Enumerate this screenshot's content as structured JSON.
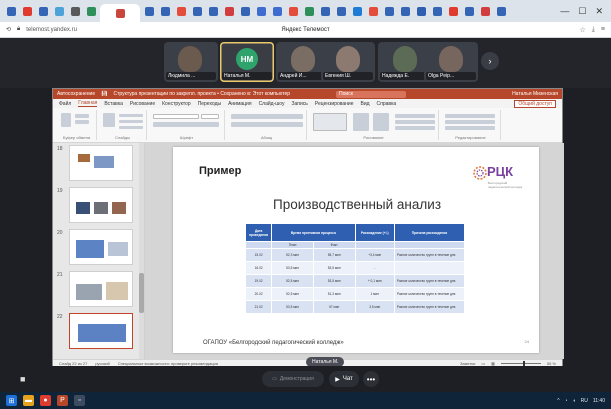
{
  "browser": {
    "url": "telemost.yandex.ru",
    "page_title": "Яндекс Телемост",
    "tab_icon_colors": [
      "#3466b5",
      "#e03b2f",
      "#3466b5",
      "#4da3d8",
      "#5a5a5a",
      "#2f8f5b",
      "#c9463d",
      "#3466b5",
      "#3466b5",
      "#e24d3c",
      "#3466b5",
      "#3466b5",
      "#d23d3d",
      "#3466b5",
      "#3f6ccf",
      "#3f6ccf",
      "#e24d3c",
      "#2f8f5b",
      "#3466b5",
      "#3466b5",
      "#1e7bd6",
      "#e24d3c",
      "#3466b5",
      "#3466b5",
      "#2e5fb0",
      "#3466b5",
      "#e03b2f",
      "#3466b5",
      "#d23d3d",
      "#3466b5"
    ]
  },
  "participants": [
    {
      "name": "Людмила ...",
      "initials": "",
      "photo_color": "#6b5a4e"
    },
    {
      "name": "Наталья М.",
      "initials": "НМ",
      "speaking": true
    },
    {
      "name": "Андрей И...",
      "initials": "",
      "photo_color": "#7a6d63"
    },
    {
      "name": "Евгения Ш.",
      "initials": "",
      "photo_color": "#8c7a70"
    },
    {
      "name": "Надежда Е.",
      "initials": "",
      "photo_color": "#5c6b55"
    },
    {
      "name": "Olga Рeip...",
      "initials": "",
      "photo_color": "#77665e"
    }
  ],
  "ppt": {
    "autosave_label": "Автосохранение",
    "doc_title": "Структура презентации по закрепл. проекта • Сохранено в: Этот компьютер",
    "search_placeholder": "Поиск",
    "user_name": "Наталья Мизенская",
    "menu": [
      "Файл",
      "Главная",
      "Вставка",
      "Рисование",
      "Конструктор",
      "Переходы",
      "Анимация",
      "Слайд-шоу",
      "Запись",
      "Рецензирование",
      "Вид",
      "Справка"
    ],
    "menu_active": "Главная",
    "share_label": "Общий доступ",
    "ribbon_groups": [
      "Буфер обмена",
      "Слайды",
      "Шрифт",
      "Абзац",
      "Рисование",
      "Редактирование"
    ],
    "slide_numbers": [
      "18",
      "19",
      "20",
      "21",
      "22"
    ],
    "status_text": "Слайд 22 из 27",
    "status_lang": "русский",
    "status_access": "Специальные возможности: проверьте рекомендации",
    "status_notes": "Заметки",
    "zoom": "55 %"
  },
  "slide": {
    "header": "Пример",
    "title": "Производственный анализ",
    "logo_text": "РЦК",
    "logo_sub": "Белгородский педагогический колледж",
    "footer": "ОГАПОУ «Белгородский педагогический колледж»",
    "number": "24",
    "table": {
      "headers": [
        "Дата проведения",
        "Время протекания процесса",
        "",
        "Расхождение (+/-)",
        "Причина расхождения"
      ],
      "subheaders": [
        "",
        "План",
        "Факт",
        "",
        ""
      ],
      "rows": [
        [
          "15.02",
          "52,3 мин",
          "55,7 мин",
          "+3,4 мин",
          "Разное количество групп в течение дня"
        ],
        [
          "16.02",
          "53,5 мин",
          "53,5 мин",
          "-",
          ""
        ],
        [
          "19.02",
          "52,5 мин",
          "53,5 мин",
          "+ 0,1 мин",
          "Разное количество групп в течение дня"
        ],
        [
          "20.02",
          "52,5 мин",
          "51,3 мин",
          "1 мин",
          "Разное количество групп в течение дня"
        ],
        [
          "21.02",
          "53,5 мин",
          "57 мин",
          "3,5 мин",
          "Разное количество групп в течение дня"
        ]
      ]
    }
  },
  "presenter_label": "Наталья М.",
  "controls": {
    "demo_label": "Демонстрация",
    "chat_label": "Чат",
    "more_label": "•••"
  },
  "taskbar": {
    "clock": "11:40",
    "lang": "RU"
  }
}
